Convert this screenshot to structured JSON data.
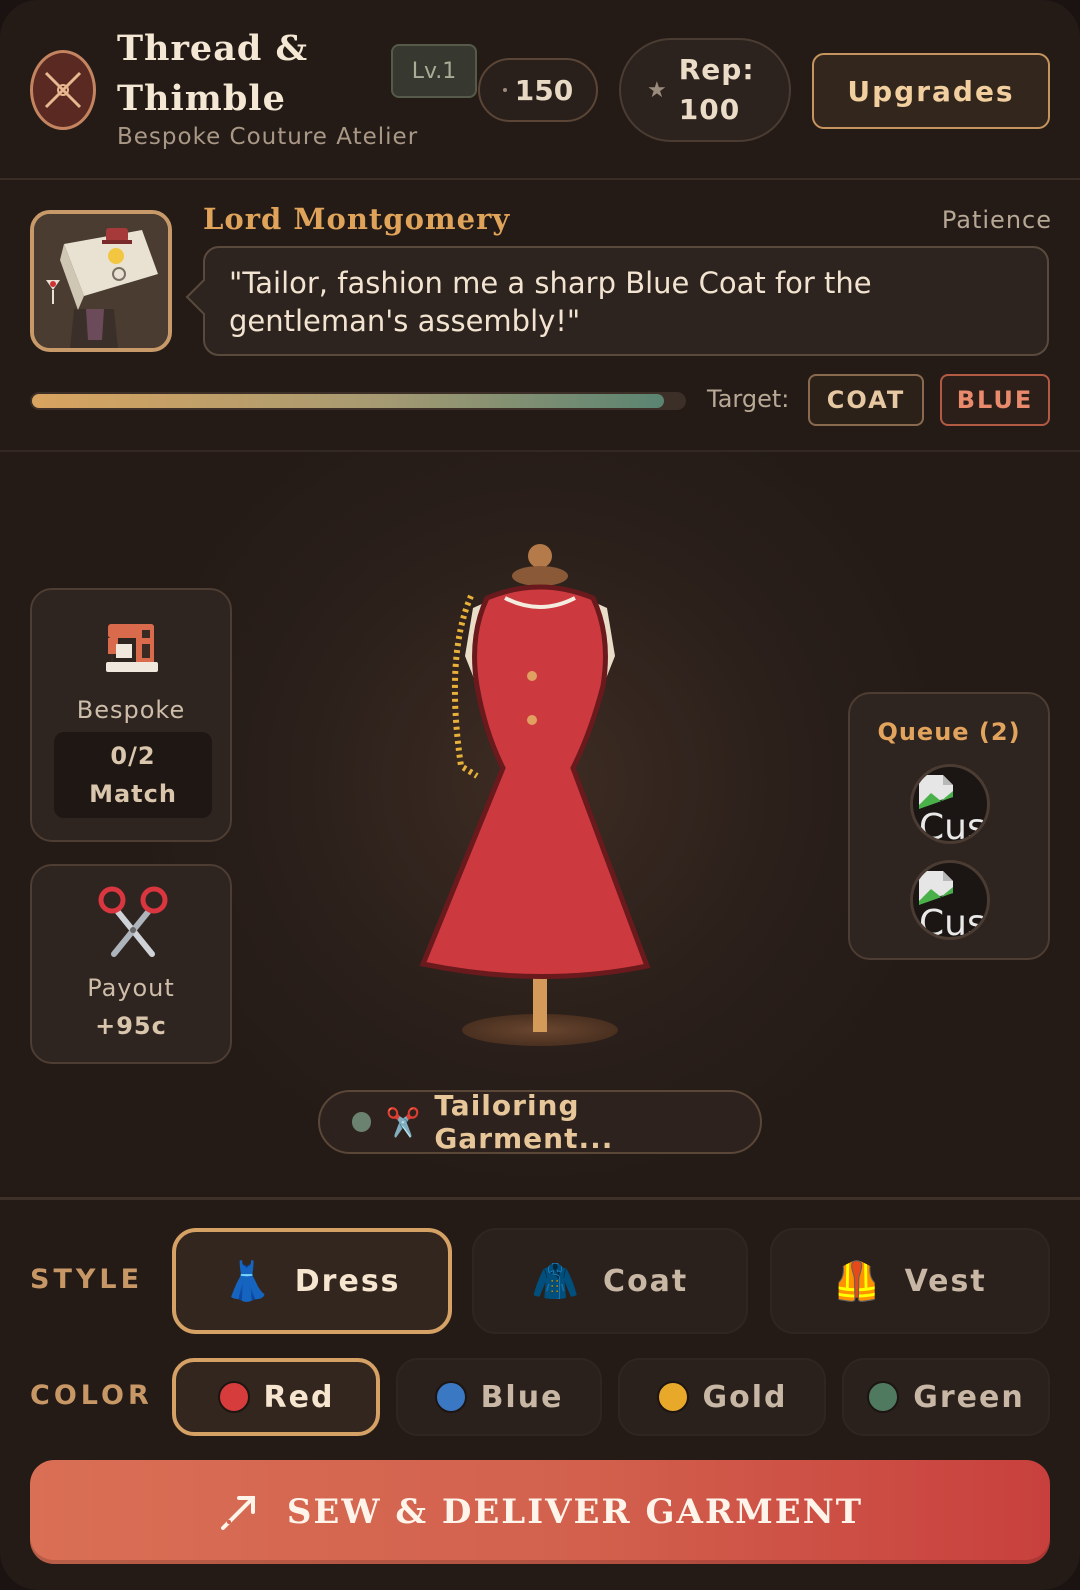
{
  "header": {
    "title": "Thread & Thimble",
    "subtitle": "Bespoke Couture Atelier",
    "level": "Lv.1",
    "coins": "150",
    "rep_label": "Rep:",
    "rep_value": "100",
    "upgrades_label": "Upgrades"
  },
  "customer": {
    "name": "Lord Montgomery",
    "patience_label": "Patience",
    "patience_level": 0.97,
    "request": "\"Tailor, fashion me a sharp Blue Coat for the gentleman's assembly!\"",
    "target_label": "Target:",
    "target_style": "COAT",
    "target_color": "BLUE"
  },
  "workshop": {
    "bespoke_label": "Bespoke",
    "match_count": "0/2",
    "match_label": "Match",
    "payout_label": "Payout",
    "payout_value": "+95c",
    "queue_title": "Queue (2)",
    "queue_items": [
      {
        "alt": "Cus"
      },
      {
        "alt": "Cus"
      }
    ],
    "status_icon": "✂️",
    "status_text": "Tailoring Garment..."
  },
  "style": {
    "label": "STYLE",
    "options": [
      {
        "label": "Dress",
        "icon": "👗",
        "selected": true
      },
      {
        "label": "Coat",
        "icon": "🧥",
        "selected": false
      },
      {
        "label": "Vest",
        "icon": "🦺",
        "selected": false
      }
    ]
  },
  "color": {
    "label": "COLOR",
    "options": [
      {
        "label": "Red",
        "hex": "#d63c3c",
        "selected": true
      },
      {
        "label": "Blue",
        "hex": "#3b78c4",
        "selected": false
      },
      {
        "label": "Gold",
        "hex": "#e8a92b",
        "selected": false
      },
      {
        "label": "Green",
        "hex": "#4f7a60",
        "selected": false
      }
    ]
  },
  "action": {
    "sew_label": "SEW & DELIVER GARMENT"
  },
  "colors": {
    "accent": "#d6a165",
    "garment": "#c9383d",
    "button": "#d2604d"
  }
}
